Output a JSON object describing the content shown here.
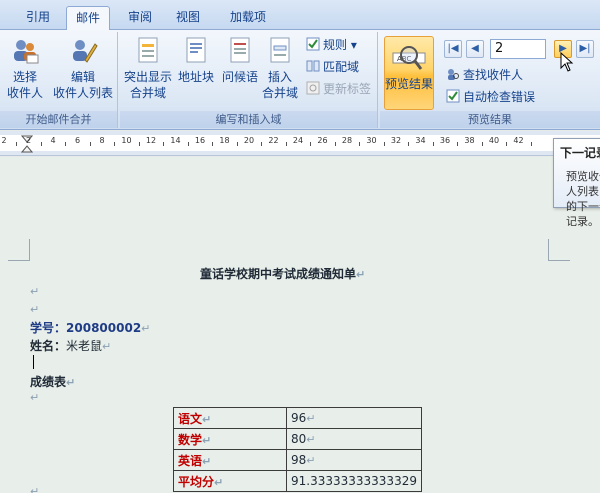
{
  "tabs": [
    "引用",
    "邮件",
    "审阅",
    "视图",
    "加载项"
  ],
  "active_tab": "邮件",
  "groups": {
    "start_merge": {
      "label": "开始邮件合并",
      "select_recipients": "选择\n收件人",
      "edit_recipients": "编辑\n收件人列表"
    },
    "write_insert": {
      "label": "编写和插入域",
      "highlight_fields": "突出显示\n合并域",
      "address_block": "地址块",
      "greeting_line": "问候语",
      "insert_merge_field": "插入\n合并域",
      "rules": "规则",
      "match_fields": "匹配域",
      "update_labels": "更新标签"
    },
    "preview": {
      "label": "预览结果",
      "preview_results": "预览结果",
      "record_number": "2",
      "find_recipient": "查找收件人",
      "auto_check_errors": "自动检查错误"
    }
  },
  "ruler": {
    "ticks": [
      "2",
      "2",
      "4",
      "6",
      "8",
      "10",
      "12",
      "14",
      "16",
      "18",
      "20",
      "22",
      "24",
      "26",
      "28",
      "30",
      "32",
      "34",
      "36",
      "38",
      "40",
      "42"
    ]
  },
  "document": {
    "title": "童话学校期中考试成绩通知单",
    "student_id_label": "学号：",
    "student_id_value": "200800002",
    "name_label": "姓名：",
    "name_value": "米老鼠",
    "table_heading": "成绩表",
    "para_mark": "↵",
    "scores": [
      {
        "subject": "语文",
        "value": "96"
      },
      {
        "subject": "数学",
        "value": "80"
      },
      {
        "subject": "英语",
        "value": "98"
      },
      {
        "subject": "平均分",
        "value": "91.33333333333329"
      }
    ]
  },
  "tooltip": {
    "title": "下一记录",
    "body": "预览收件人列表中的下一个记录。"
  },
  "colors": {
    "tab_text": "#15428b",
    "subject_red": "#c00000",
    "highlight_orange": "#ffbf3a"
  }
}
